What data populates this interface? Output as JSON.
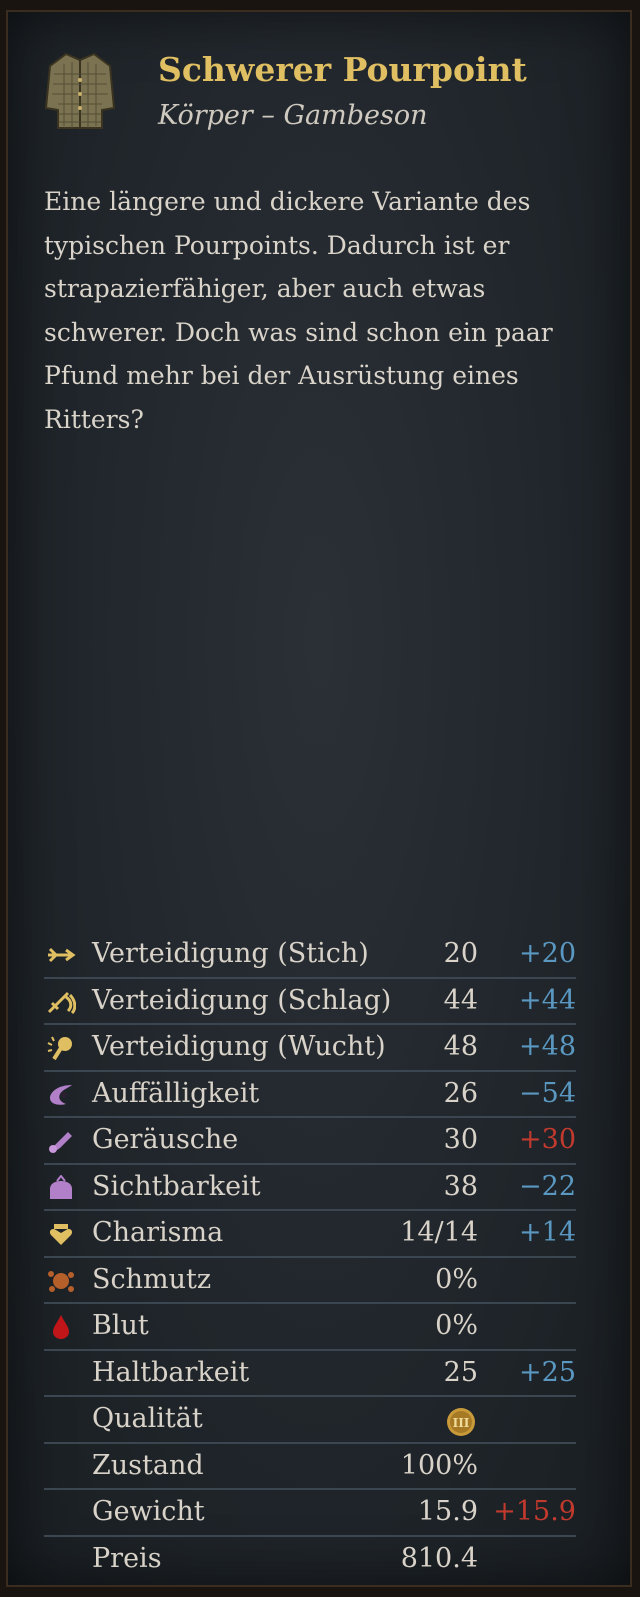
{
  "item": {
    "title": "Schwerer Pourpoint",
    "subtitle": "Körper – Gambeson",
    "icon": "gambeson-icon",
    "description": "Eine längere und dickere Variante des typischen Pourpoints. Dadurch ist er strapazierfähiger, aber auch etwas schwerer. Doch was sind schon ein paar Pfund mehr bei der Ausrüstung eines Ritters?"
  },
  "colors": {
    "title": "#e0bf63",
    "positive_delta": "#5a98c2",
    "negative_delta": "#c23a2e"
  },
  "stats": [
    {
      "icon": "stab-icon",
      "label": "Verteidigung (Stich)",
      "value": "20",
      "delta": "+20"
    },
    {
      "icon": "slash-icon",
      "label": "Verteidigung (Schlag)",
      "value": "44",
      "delta": "+44"
    },
    {
      "icon": "blunt-icon",
      "label": "Verteidigung (Wucht)",
      "value": "48",
      "delta": "+48"
    },
    {
      "icon": "conspicuousness-icon",
      "label": "Auffälligkeit",
      "value": "26",
      "delta": "−54"
    },
    {
      "icon": "noise-icon",
      "label": "Geräusche",
      "value": "30",
      "delta": "+30"
    },
    {
      "icon": "visibility-icon",
      "label": "Sichtbarkeit",
      "value": "38",
      "delta": "−22"
    },
    {
      "icon": "charisma-icon",
      "label": "Charisma",
      "value": "14/14",
      "delta": "+14"
    },
    {
      "icon": "dirt-icon",
      "label": "Schmutz",
      "value": "0%",
      "delta": ""
    },
    {
      "icon": "blood-icon",
      "label": "Blut",
      "value": "0%",
      "delta": ""
    },
    {
      "icon": "",
      "label": "Haltbarkeit",
      "value": "25",
      "delta": "+25"
    },
    {
      "icon": "",
      "label": "Qualität",
      "value": "",
      "delta": "",
      "badge": "quality-badge-icon",
      "badge_text": "III"
    },
    {
      "icon": "",
      "label": "Zustand",
      "value": "100%",
      "delta": ""
    },
    {
      "icon": "",
      "label": "Gewicht",
      "value": "15.9",
      "delta": "+15.9"
    },
    {
      "icon": "",
      "label": "Preis",
      "value": "810.4",
      "delta": ""
    }
  ]
}
